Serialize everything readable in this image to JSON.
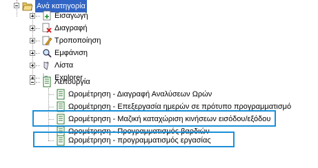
{
  "tree": {
    "root": {
      "label": "Ανά κατηγορία",
      "icon": "folder-open-icon",
      "selected": true
    },
    "groups": [
      {
        "label": "Εισαγωγή",
        "icon": "insert-icon"
      },
      {
        "label": "Διαγραφή",
        "icon": "delete-icon"
      },
      {
        "label": "Τροποποίηση",
        "icon": "edit-icon"
      },
      {
        "label": "Εμφάνιση",
        "icon": "view-icon"
      },
      {
        "label": "Λίστα",
        "icon": "list-icon"
      },
      {
        "label": "Explorer",
        "icon": "explorer-icon"
      }
    ],
    "function_group": {
      "label": "Λειτουργία",
      "icon": "document-icon",
      "items": [
        {
          "label": "Ωρομέτρηση - Διαγραφή Αναλύσεων Ωρών"
        },
        {
          "label": "Ωρομέτρηση - Επεξεργασία ημερών σε πρότυπο προγραμματισμό"
        },
        {
          "label": "Ωρομέτρηση - Μαζική καταχώριση κινήσεων εισόδου/εξόδου",
          "highlighted": true
        },
        {
          "label": "Ωρομέτρηση - Προγραμματισμός βαρδιών"
        },
        {
          "label": "Ωρομέτρηση - προγραμματισμός εργασίας",
          "highlighted": true
        }
      ]
    }
  },
  "colors": {
    "selection": "#3165c5",
    "highlight_box": "#1a8fd8"
  }
}
